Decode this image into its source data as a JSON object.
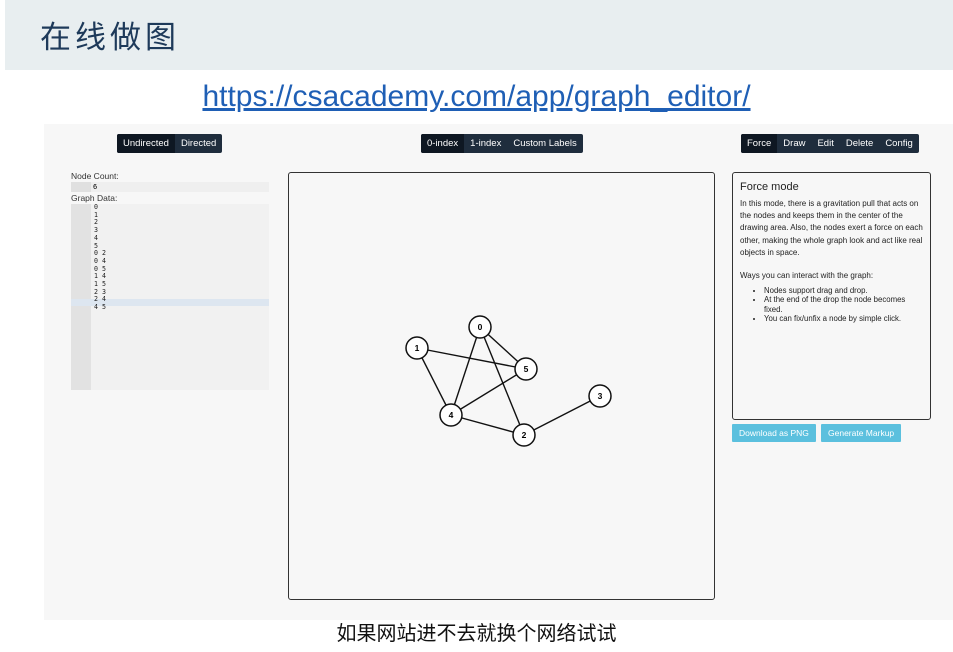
{
  "slide": {
    "title": "在线做图",
    "link": "https://csacademy.com/app/graph_editor/",
    "caption": "如果网站进不去就换个网络试试"
  },
  "app": {
    "direction_toggle": [
      {
        "label": "Undirected",
        "active": true
      },
      {
        "label": "Directed",
        "active": false
      }
    ],
    "index_toggle": [
      {
        "label": "0-index",
        "active": true
      },
      {
        "label": "1-index",
        "active": false
      },
      {
        "label": "Custom Labels",
        "active": false
      }
    ],
    "mode_toggle": [
      {
        "label": "Force",
        "active": true
      },
      {
        "label": "Draw",
        "active": false
      },
      {
        "label": "Edit",
        "active": false
      },
      {
        "label": "Delete",
        "active": false
      },
      {
        "label": "Config",
        "active": false
      }
    ],
    "sidebar": {
      "node_count_label": "Node Count:",
      "node_count_value": "6",
      "graph_data_label": "Graph Data:",
      "graph_data_lines": [
        "0",
        "1",
        "2",
        "3",
        "4",
        "5",
        "0 2",
        "0 4",
        "0 5",
        "1 4",
        "1 5",
        "2 3",
        "2 4",
        "4 5"
      ]
    },
    "graph": {
      "nodes": [
        "0",
        "1",
        "2",
        "3",
        "4",
        "5"
      ],
      "edges": [
        [
          "0",
          "2"
        ],
        [
          "0",
          "4"
        ],
        [
          "0",
          "5"
        ],
        [
          "1",
          "4"
        ],
        [
          "1",
          "5"
        ],
        [
          "2",
          "3"
        ],
        [
          "2",
          "4"
        ],
        [
          "4",
          "5"
        ]
      ]
    },
    "info_panel": {
      "title": "Force mode",
      "description": "In this mode, there is a gravitation pull that acts on the nodes and keeps them in the center of the drawing area. Also, the nodes exert a force on each other, making the whole graph look and act like real objects in space.",
      "ways_heading": "Ways you can interact with the graph:",
      "ways": [
        "Nodes support drag and drop.",
        "At the end of the drop the node becomes fixed.",
        "You can fix/unfix a node by simple click."
      ]
    },
    "actions": {
      "download_label": "Download as PNG",
      "markup_label": "Generate Markup"
    },
    "colors": {
      "toolbar_bg": "#1f2d3d",
      "action_button": "#5bc0de",
      "link": "#1f5fb5"
    }
  }
}
